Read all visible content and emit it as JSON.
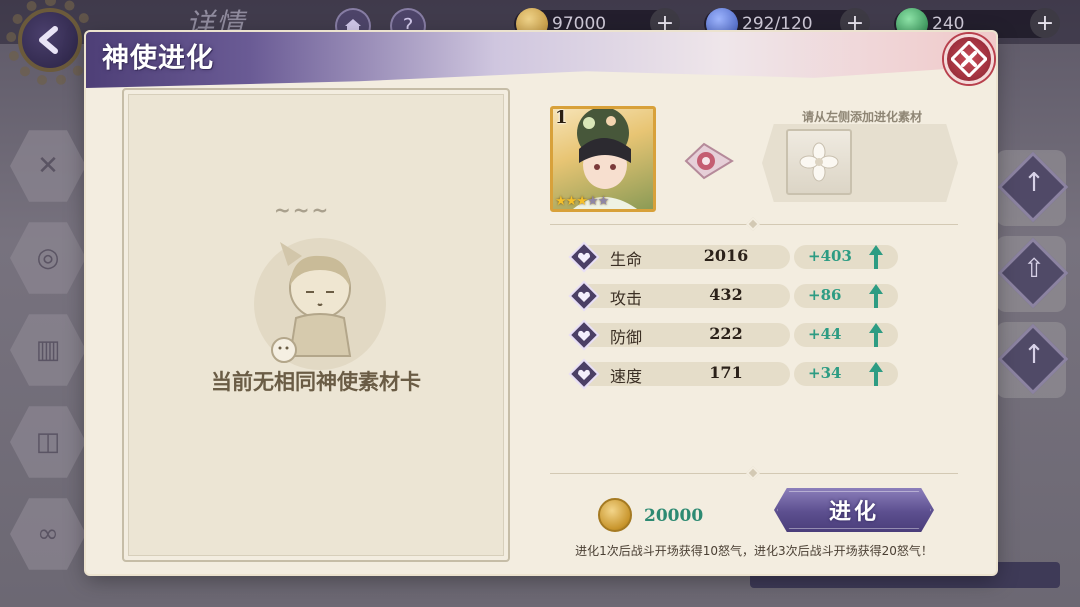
{
  "background": {
    "title": "详情",
    "resources": [
      {
        "name": "coin",
        "value": "97000",
        "color": "#c99b3a"
      },
      {
        "name": "energy",
        "value": "292/120",
        "color": "#4a6fd8"
      },
      {
        "name": "gem",
        "value": "240",
        "color": "#2c9a55"
      }
    ],
    "home_icon": "home-icon",
    "help_icon": "?"
  },
  "dialog": {
    "title": "神使进化",
    "empty_message": "当前无相同神使素材卡",
    "zzz": "~~~",
    "hero": {
      "level": "1",
      "stars_filled": 3,
      "stars_total": 5
    },
    "material_hint": "请从左侧添加进化素材",
    "stats": [
      {
        "name": "生命",
        "value": "2016",
        "bonus": "+403"
      },
      {
        "name": "攻击",
        "value": "432",
        "bonus": "+86"
      },
      {
        "name": "防御",
        "value": "222",
        "bonus": "+44"
      },
      {
        "name": "速度",
        "value": "171",
        "bonus": "+34"
      }
    ],
    "cost": "20000",
    "evolve_button": "进化",
    "note": "进化1次后战斗开场获得10怒气，进化3次后战斗开场获得20怒气！"
  },
  "colors": {
    "accent_purple": "#5c4f8f",
    "bonus_green": "#2d9c83",
    "close_red": "#b8404d",
    "panel_bg": "#f3ede0"
  }
}
